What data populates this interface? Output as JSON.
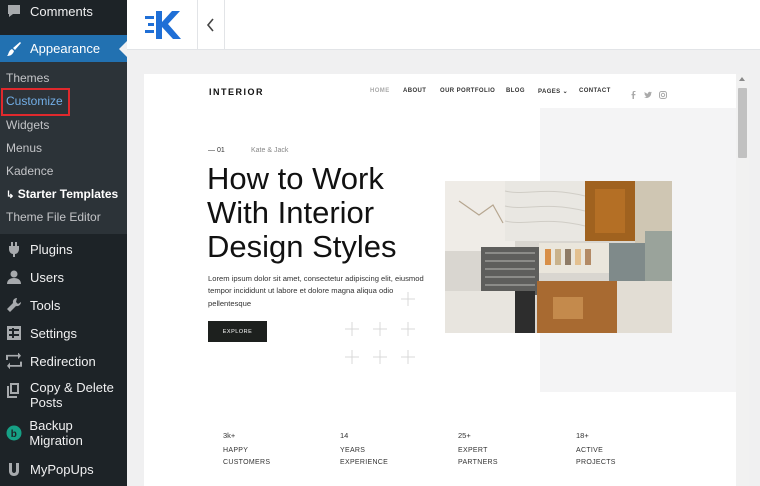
{
  "sidebar": {
    "items": [
      {
        "label": "Comments",
        "icon": "comment-icon"
      },
      {
        "label": "Appearance",
        "icon": "paintbrush-icon"
      },
      {
        "label": "Plugins",
        "icon": "plug-icon"
      },
      {
        "label": "Users",
        "icon": "user-icon"
      },
      {
        "label": "Tools",
        "icon": "wrench-icon"
      },
      {
        "label": "Settings",
        "icon": "settings-icon"
      },
      {
        "label": "Redirection",
        "icon": "redirect-icon"
      },
      {
        "label": "Copy & Delete Posts",
        "icon": "copy-icon"
      },
      {
        "label": "Backup Migration",
        "icon": "backup-icon"
      },
      {
        "label": "MyPopUps",
        "icon": "popup-icon"
      }
    ],
    "appearance_submenu": [
      "Themes",
      "Customize",
      "Widgets",
      "Menus",
      "Kadence",
      "Starter Templates",
      "Theme File Editor"
    ],
    "accent_color": "#2271b1",
    "highlight_color": "#e0292d"
  },
  "site": {
    "logo": "INTERIOR",
    "nav": [
      "HOME",
      "ABOUT",
      "OUR PORTFOLIO",
      "BLOG",
      "PAGES",
      "CONTACT"
    ],
    "hero": {
      "number": "— 01",
      "author": "Kate & Jack",
      "title": "How to Work With Interior Design Styles",
      "body": "Lorem ipsum dolor sit amet, consectetur adipiscing elit, eiusmod tempor incididunt ut labore et dolore magna aliqua odio pellentesque",
      "button": "EXPLORE"
    },
    "stats": [
      {
        "number": "3k+",
        "line1": "HAPPY",
        "line2": "CUSTOMERS"
      },
      {
        "number": "14",
        "line1": "YEARS",
        "line2": "EXPERIENCE"
      },
      {
        "number": "25+",
        "line1": "EXPERT",
        "line2": "PARTNERS"
      },
      {
        "number": "18+",
        "line1": "ACTIVE",
        "line2": "PROJECTS"
      }
    ]
  }
}
